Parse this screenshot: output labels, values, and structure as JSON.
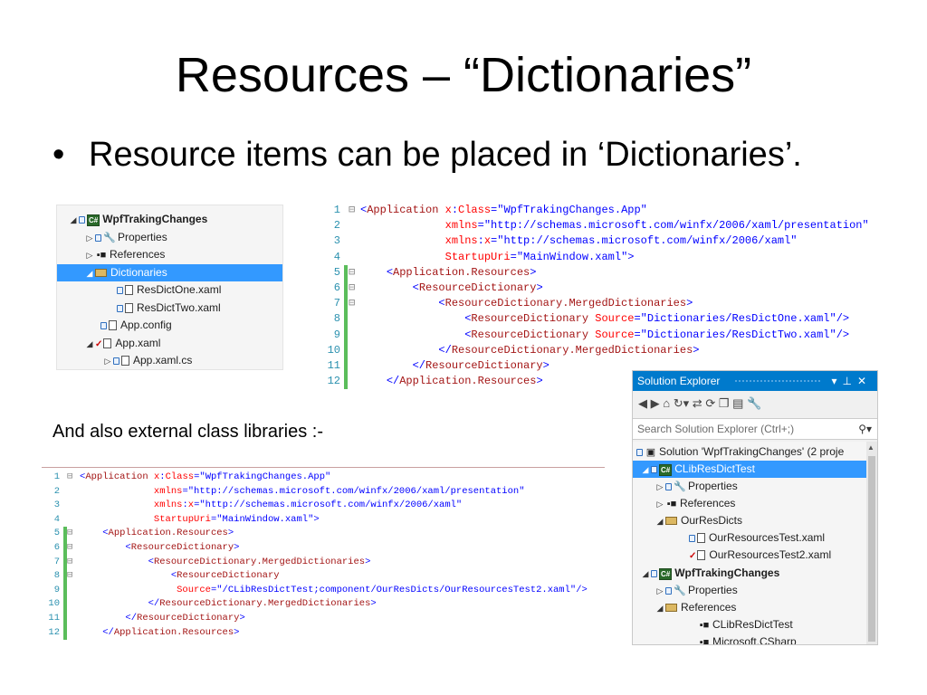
{
  "slide": {
    "title": "Resources – “Dictionaries”",
    "bullet": "Resource items can be placed in ‘Dictionaries’.",
    "caption": "And also external class libraries :-"
  },
  "tree1": {
    "items": [
      {
        "label": "WpfTrakingChanges"
      },
      {
        "label": "Properties"
      },
      {
        "label": "References"
      },
      {
        "label": "Dictionaries"
      },
      {
        "label": "ResDictOne.xaml"
      },
      {
        "label": "ResDictTwo.xaml"
      },
      {
        "label": "App.config"
      },
      {
        "label": "App.xaml"
      },
      {
        "label": "App.xaml.cs"
      }
    ]
  },
  "code1": {
    "line_numbers": [
      "1",
      "2",
      "3",
      "4",
      "5",
      "6",
      "7",
      "8",
      "9",
      "10",
      "11",
      "12"
    ],
    "lines": [
      "<Application x:Class=\"WpfTrakingChanges.App\"",
      "             xmlns=\"http://schemas.microsoft.com/winfx/2006/xaml/presentation\"",
      "             xmlns:x=\"http://schemas.microsoft.com/winfx/2006/xaml\"",
      "             StartupUri=\"MainWindow.xaml\">",
      "    <Application.Resources>",
      "        <ResourceDictionary>",
      "            <ResourceDictionary.MergedDictionaries>",
      "                <ResourceDictionary Source=\"Dictionaries/ResDictOne.xaml\"/>",
      "                <ResourceDictionary Source=\"Dictionaries/ResDictTwo.xaml\"/>",
      "            </ResourceDictionary.MergedDictionaries>",
      "        </ResourceDictionary>",
      "    </Application.Resources>"
    ]
  },
  "code2": {
    "line_numbers": [
      "1",
      "2",
      "3",
      "4",
      "5",
      "6",
      "7",
      "8",
      "9",
      "10",
      "11",
      "12"
    ],
    "lines": [
      "<Application x:Class=\"WpfTrakingChanges.App\"",
      "             xmlns=\"http://schemas.microsoft.com/winfx/2006/xaml/presentation\"",
      "             xmlns:x=\"http://schemas.microsoft.com/winfx/2006/xaml\"",
      "             StartupUri=\"MainWindow.xaml\">",
      "    <Application.Resources>",
      "        <ResourceDictionary>",
      "            <ResourceDictionary.MergedDictionaries>",
      "                <ResourceDictionary",
      "                 Source=\"/CLibResDictTest;component/OurResDicts/OurResourcesTest2.xaml\"/>",
      "            </ResourceDictionary.MergedDictionaries>",
      "        </ResourceDictionary>",
      "    </Application.Resources>"
    ]
  },
  "solution_explorer": {
    "title": "Solution Explorer",
    "search_placeholder": "Search Solution Explorer (Ctrl+;)",
    "items": [
      {
        "label": "Solution 'WpfTrakingChanges' (2 proje"
      },
      {
        "label": "CLibResDictTest"
      },
      {
        "label": "Properties"
      },
      {
        "label": "References"
      },
      {
        "label": "OurResDicts"
      },
      {
        "label": "OurResourcesTest.xaml"
      },
      {
        "label": "OurResourcesTest2.xaml"
      },
      {
        "label": "WpfTrakingChanges"
      },
      {
        "label": "Properties"
      },
      {
        "label": "References"
      },
      {
        "label": "CLibResDictTest"
      },
      {
        "label": "Microsoft.CSharp"
      }
    ]
  },
  "colors": {
    "selection": "#3399ff",
    "title_bar": "#007acc",
    "line_number": "#2b91af",
    "tag": "#a31515",
    "attribute": "#ff0000",
    "value": "#0000ff",
    "change_bar": "#5bbd5b"
  }
}
